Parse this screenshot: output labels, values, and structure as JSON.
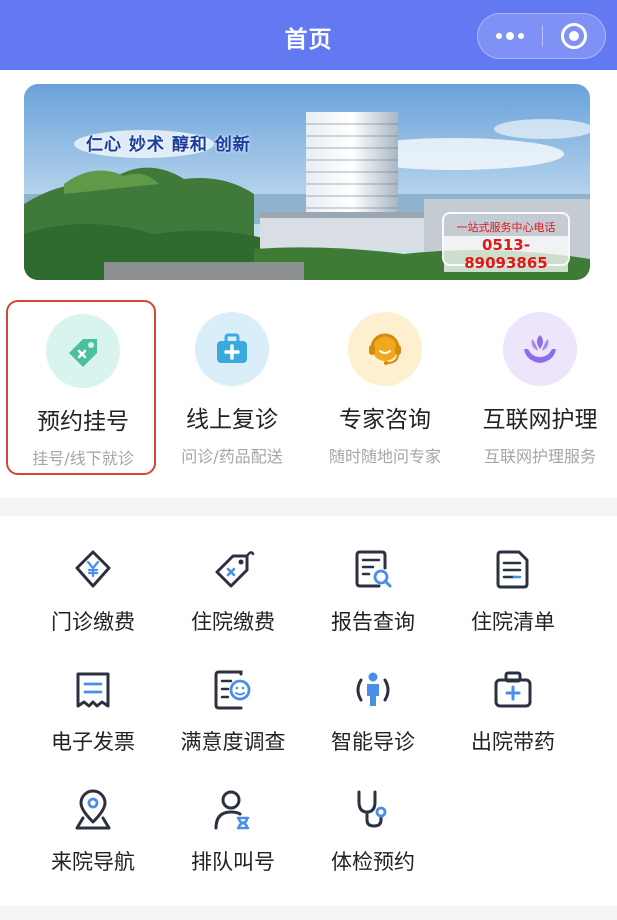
{
  "header": {
    "title": "首页"
  },
  "banner": {
    "slogan": "仁心 妙术 醇和 创新",
    "hotline_label": "一站式服务中心电话",
    "hotline_number": "0513-89093865"
  },
  "services": [
    {
      "label": "预约挂号",
      "sublabel": "挂号/线下就诊",
      "icon": "tag-icon",
      "color": "#4dbfa0",
      "bg": "#d9f4ee"
    },
    {
      "label": "线上复诊",
      "sublabel": "问诊/药品配送",
      "icon": "medical-kit-icon",
      "color": "#3aa9de",
      "bg": "#d9eef8"
    },
    {
      "label": "专家咨询",
      "sublabel": "随时随地问专家",
      "icon": "headset-icon",
      "color": "#f0a81e",
      "bg": "#fdf0cf"
    },
    {
      "label": "互联网护理",
      "sublabel": "互联网护理服务",
      "icon": "care-hands-icon",
      "color": "#8d6de6",
      "bg": "#ece5fb"
    }
  ],
  "grid": [
    {
      "label": "门诊缴费",
      "icon": "yuan-tag-icon"
    },
    {
      "label": "住院缴费",
      "icon": "price-tag-icon"
    },
    {
      "label": "报告查询",
      "icon": "report-search-icon"
    },
    {
      "label": "住院清单",
      "icon": "document-list-icon"
    },
    {
      "label": "电子发票",
      "icon": "invoice-icon"
    },
    {
      "label": "满意度调查",
      "icon": "survey-icon"
    },
    {
      "label": "智能导诊",
      "icon": "guide-person-icon"
    },
    {
      "label": "出院带药",
      "icon": "medicine-box-icon"
    },
    {
      "label": "来院导航",
      "icon": "location-pin-icon"
    },
    {
      "label": "排队叫号",
      "icon": "queue-icon"
    },
    {
      "label": "体检预约",
      "icon": "stethoscope-icon"
    }
  ],
  "colors": {
    "header": "#6379f2",
    "highlight_border": "#d1453b",
    "icon_dark": "#2c3142",
    "icon_accent": "#4a8ee8"
  }
}
